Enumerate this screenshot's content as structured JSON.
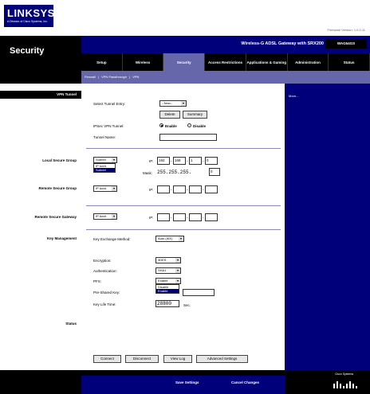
{
  "brand": {
    "logo": "LINKSYS",
    "logo_sub": "A Division of Cisco Systems, Inc.",
    "firmware": "Firmware Version: 1.0.0.11"
  },
  "header": {
    "section": "Security",
    "product": "Wireless-G ADSL Gateway with SRX200",
    "model": "WAG54GS"
  },
  "tabs": [
    {
      "label": "Setup"
    },
    {
      "label": "Wireless"
    },
    {
      "label": "Security"
    },
    {
      "label": "Access Restrictions"
    },
    {
      "label": "Applications & Gaming"
    },
    {
      "label": "Administration"
    },
    {
      "label": "Status"
    }
  ],
  "subtabs": [
    "Firewall",
    "|",
    "VPN Passthrough",
    "|",
    "VPN"
  ],
  "sections": {
    "vpn_tunnel": "VPN Tunnel",
    "local_secure_group": "Local Secure Group",
    "remote_secure_group": "Remote Secure Group",
    "remote_secure_gateway": "Remote Secure Gateway",
    "key_management": "Key Management",
    "status": "Status"
  },
  "vpn_tunnel": {
    "select_label": "Select Tunnel Entry:",
    "select_value": "--New--",
    "delete_btn": "Delete",
    "summary_btn": "Summary",
    "ipsec_label": "IPSec VPN Tunnel:",
    "enable": "Enable",
    "disable": "Disable",
    "tunnel_name_label": "Tunnel Name:",
    "tunnel_name_value": ""
  },
  "local_group": {
    "type_value": "Subnet",
    "dropdown_options": [
      "IP Addr.",
      "Subnet"
    ],
    "ip_label": "IP:",
    "ip": [
      "192",
      "168",
      "1",
      "0"
    ],
    "mask_label": "Mask:",
    "mask_text": "255.255.255.",
    "mask_last": "0"
  },
  "remote_group": {
    "type_value": "IP Addr.",
    "ip_label": "IP:",
    "ip": [
      "",
      "",
      "",
      ""
    ]
  },
  "remote_gateway": {
    "type_value": "IP Addr.",
    "ip_label": "IP:",
    "ip": [
      "",
      "",
      "",
      ""
    ]
  },
  "key_mgmt": {
    "exchange_label": "Key Exchange Method:",
    "exchange_value": "Auto (IKE)",
    "encryption_label": "Encryption:",
    "encryption_value": "3DES",
    "auth_label": "Authentication:",
    "auth_value": "SHA1",
    "pfs_label": "PFS:",
    "pfs_value": "Enable",
    "pfs_options": [
      "Disable",
      "Enable"
    ],
    "psk_label": "Pre-Shared Key:",
    "psk_value": "",
    "lifetime_label": "Key Life Time:",
    "lifetime_value": "28800",
    "lifetime_unit": "Sec."
  },
  "status_buttons": {
    "connect": "Connect",
    "disconnect": "Disconnect",
    "view_log": "View Log",
    "advanced": "Advanced Settings"
  },
  "footer": {
    "save": "Save Settings",
    "cancel": "Cancel Changes",
    "cisco": "Cisco Systems"
  },
  "help": {
    "more": "More..."
  },
  "colors": {
    "navy": "#00007b",
    "black": "#000000",
    "tab_active": "#6666aa"
  }
}
